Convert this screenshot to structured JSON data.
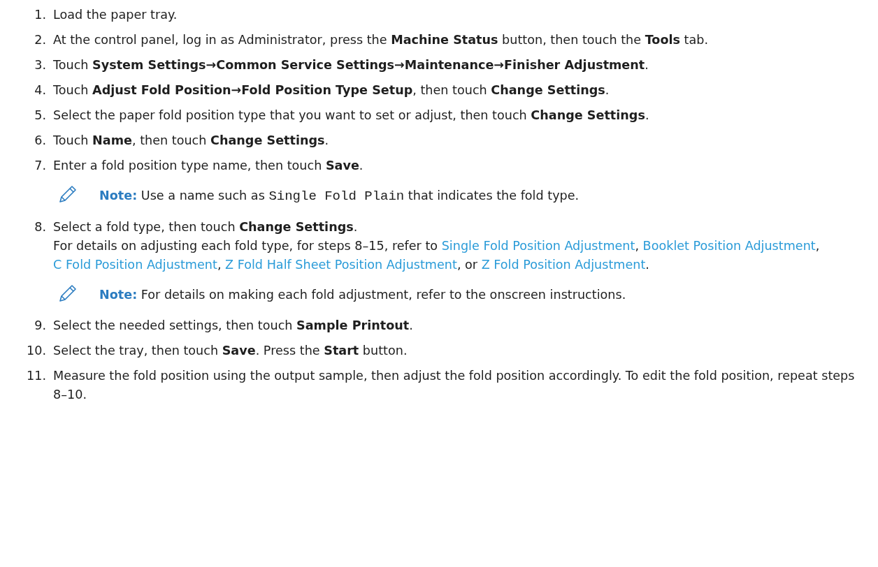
{
  "steps": [
    {
      "number": "1.",
      "text": "Load the paper tray."
    },
    {
      "number": "2.",
      "text": "At the control panel, log in as Administrator, press the **Machine Status** button, then touch the **Tools** tab."
    },
    {
      "number": "3.",
      "text": "Touch **System Settings→Common Service Settings→Maintenance→Finisher Adjustment**."
    },
    {
      "number": "4.",
      "text": "Touch **Adjust Fold Position→Fold Position Type Setup**, then touch **Change Settings**."
    },
    {
      "number": "5.",
      "text": "Select the paper fold position type that you want to set or adjust, then touch **Change Settings**."
    },
    {
      "number": "6.",
      "text": "Touch **Name**, then touch **Change Settings**."
    },
    {
      "number": "7.",
      "text": "Enter a fold position type name, then touch **Save**.",
      "note": [
        {
          "kind": "label",
          "text": "Note:"
        },
        {
          "kind": "text",
          "text": " Use a name such as "
        },
        {
          "kind": "code",
          "text": "Single Fold Plain"
        },
        {
          "kind": "text",
          "text": " that indicates the fold type."
        }
      ]
    },
    {
      "number": "8.",
      "text": "Select a fold type, then touch **Change Settings**.",
      "detail": [
        {
          "kind": "text",
          "text": "For details on adjusting each fold type, for steps 8–15, refer to "
        },
        {
          "kind": "link",
          "text": "Single Fold Position Adjustment"
        },
        {
          "kind": "text",
          "text": ", "
        },
        {
          "kind": "link",
          "text": "Booklet Position Adjustment"
        },
        {
          "kind": "text",
          "text": ", "
        },
        {
          "kind": "link",
          "text": "C Fold Position Adjustment"
        },
        {
          "kind": "text",
          "text": ", "
        },
        {
          "kind": "link",
          "text": "Z Fold Half Sheet Position Adjustment"
        },
        {
          "kind": "text",
          "text": ", or "
        },
        {
          "kind": "link",
          "text": "Z Fold Position Adjustment"
        },
        {
          "kind": "text",
          "text": "."
        }
      ],
      "note": [
        {
          "kind": "label",
          "text": "Note:"
        },
        {
          "kind": "text",
          "text": " For details on making each fold adjustment, refer to the onscreen instructions."
        }
      ]
    },
    {
      "number": "9.",
      "text": "Select the needed settings, then touch **Sample Printout**."
    },
    {
      "number": "10.",
      "text": "Select the tray, then touch **Save**. Press the **Start** button."
    },
    {
      "number": "11.",
      "text": "Measure the fold position using the output sample, then adjust the fold position accordingly. To edit the fold position, repeat steps 8–10."
    }
  ]
}
